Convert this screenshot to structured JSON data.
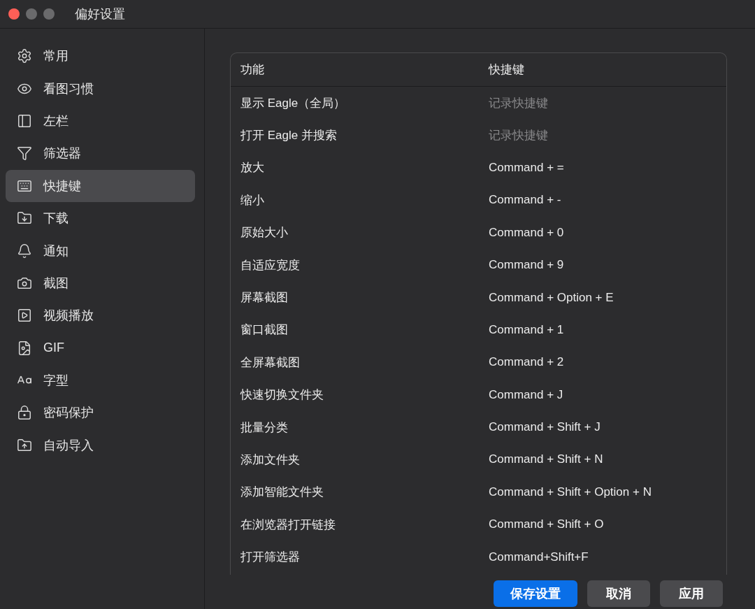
{
  "window": {
    "title": "偏好设置"
  },
  "sidebar": {
    "items": [
      {
        "label": "常用",
        "selected": false
      },
      {
        "label": "看图习惯",
        "selected": false
      },
      {
        "label": "左栏",
        "selected": false
      },
      {
        "label": "筛选器",
        "selected": false
      },
      {
        "label": "快捷键",
        "selected": true
      },
      {
        "label": "下载",
        "selected": false
      },
      {
        "label": "通知",
        "selected": false
      },
      {
        "label": "截图",
        "selected": false
      },
      {
        "label": "视频播放",
        "selected": false
      },
      {
        "label": "GIF",
        "selected": false
      },
      {
        "label": "字型",
        "selected": false
      },
      {
        "label": "密码保护",
        "selected": false
      },
      {
        "label": "自动导入",
        "selected": false
      }
    ]
  },
  "table": {
    "columns": [
      "功能",
      "快捷键"
    ],
    "rows": [
      {
        "action": "显示 Eagle（全局）",
        "shortcut": "记录快捷键",
        "kind": "hint"
      },
      {
        "action": "打开 Eagle 并搜索",
        "shortcut": "记录快捷键",
        "kind": "hint"
      },
      {
        "action": "放大",
        "shortcut": "Command + =",
        "kind": "keys"
      },
      {
        "action": "缩小",
        "shortcut": "Command + -",
        "kind": "keys"
      },
      {
        "action": "原始大小",
        "shortcut": "Command + 0",
        "kind": "keys"
      },
      {
        "action": "自适应宽度",
        "shortcut": "Command + 9",
        "kind": "keys"
      },
      {
        "action": "屏幕截图",
        "shortcut": "Command + Option + E",
        "kind": "keys"
      },
      {
        "action": "窗口截图",
        "shortcut": "Command + 1",
        "kind": "keys"
      },
      {
        "action": "全屏幕截图",
        "shortcut": "Command + 2",
        "kind": "keys"
      },
      {
        "action": "快速切换文件夹",
        "shortcut": "Command + J",
        "kind": "keys"
      },
      {
        "action": "批量分类",
        "shortcut": "Command + Shift + J",
        "kind": "keys"
      },
      {
        "action": "添加文件夹",
        "shortcut": "Command + Shift + N",
        "kind": "keys"
      },
      {
        "action": "添加智能文件夹",
        "shortcut": "Command + Shift + Option + N",
        "kind": "keys"
      },
      {
        "action": "在浏览器打开链接",
        "shortcut": "Command + Shift + O",
        "kind": "keys"
      },
      {
        "action": "打开筛选器",
        "shortcut": "Command+Shift+F",
        "kind": "keys"
      }
    ]
  },
  "buttons": [
    {
      "label": "保存设置",
      "kind": "primary"
    },
    {
      "label": "取消",
      "kind": "secondary"
    },
    {
      "label": "应用",
      "kind": "secondary"
    }
  ]
}
